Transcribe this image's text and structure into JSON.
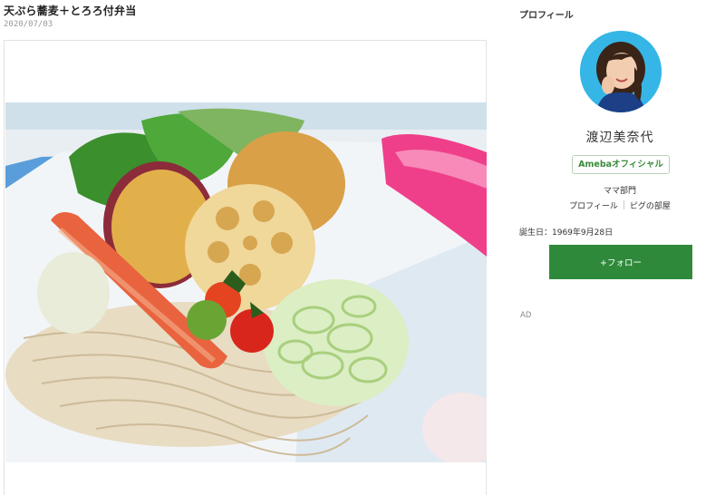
{
  "article": {
    "title": "天ぷら蕎麦＋とろろ付弁当",
    "date": "2020/07/03"
  },
  "sidebar": {
    "heading": "プロフィール",
    "name": "渡辺美奈代",
    "badge": "Amebaオフィシャル",
    "genre": "ママ部門",
    "links": [
      "プロフィール",
      "ピグの部屋"
    ],
    "birthday": "誕生日：1969年9月28日",
    "follow_label": "+フォロー",
    "ad_label": "AD"
  },
  "colors": {
    "accent_green": "#2e8a3a",
    "avatar_bg": "#35b6e6"
  }
}
